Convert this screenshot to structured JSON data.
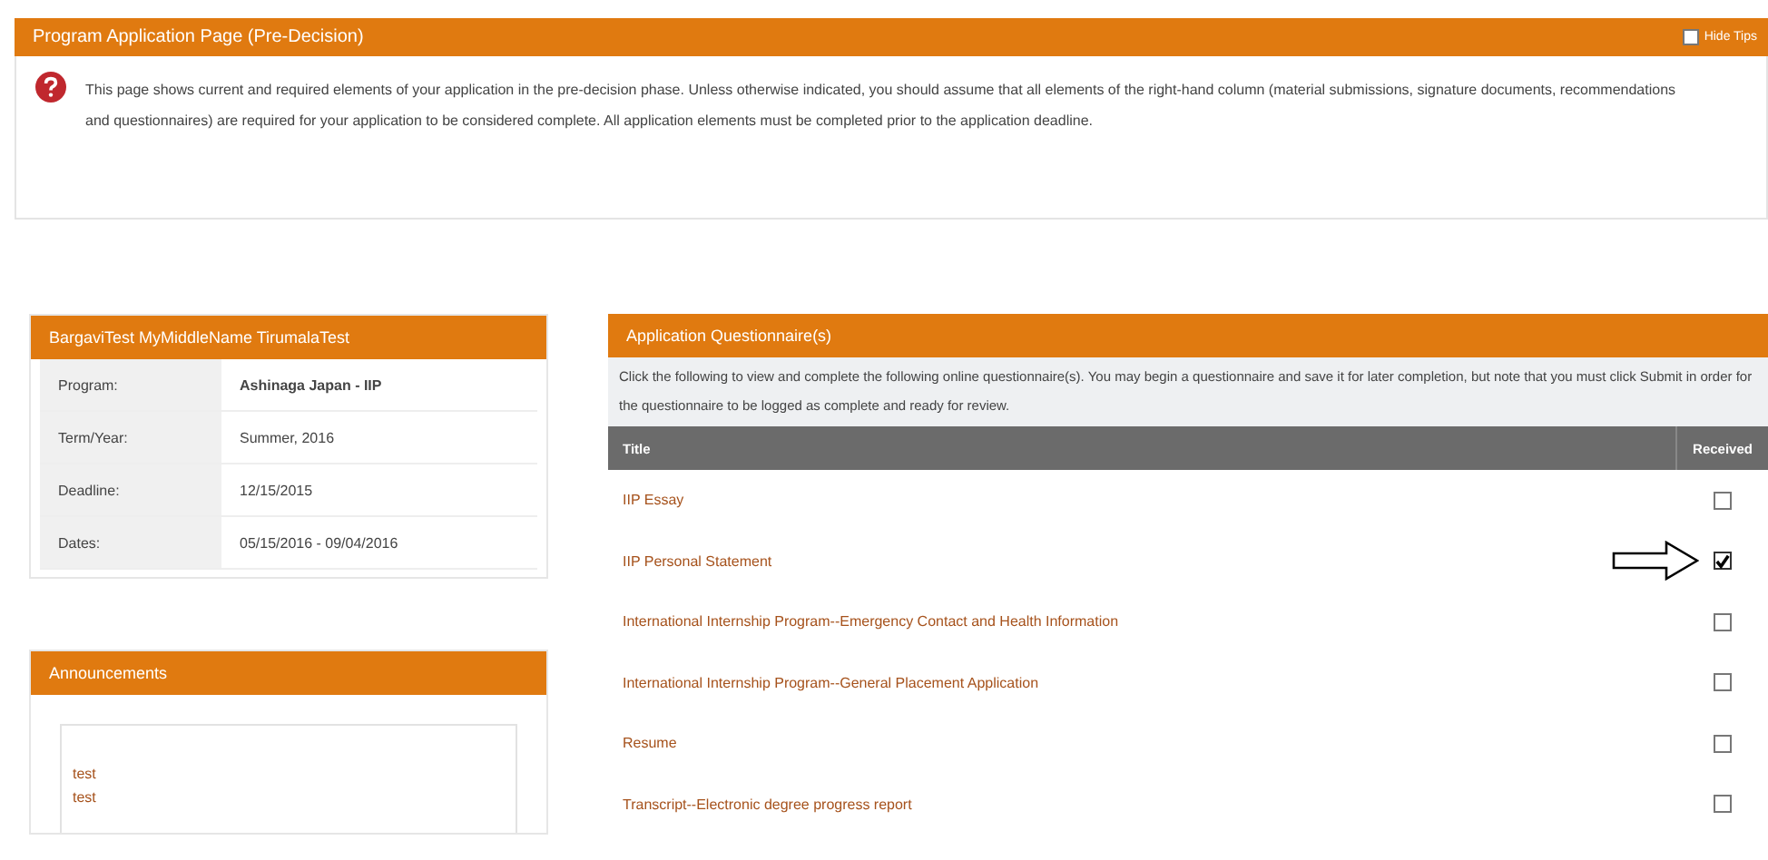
{
  "header": {
    "title": "Program Application Page (Pre-Decision)",
    "hide_tips": {
      "label": "Hide Tips",
      "checked": false
    }
  },
  "notice": "This page shows current and required elements of your application in the pre-decision phase. Unless otherwise indicated, you should assume that all elements of the right-hand column (material submissions, signature documents, recommendations and questionnaires) are required for your application to be considered complete. All application elements must be completed prior to the application deadline.",
  "applicant": {
    "title": "BargaviTest MyMiddleName TirumalaTest",
    "rows": [
      {
        "label": "Program:",
        "value": "Ashinaga Japan - IIP",
        "bold": true
      },
      {
        "label": "Term/Year:",
        "value": "Summer, 2016",
        "bold": false
      },
      {
        "label": "Deadline:",
        "value": "12/15/2015",
        "bold": false
      },
      {
        "label": "Dates:",
        "value": "05/15/2016 - 09/04/2016",
        "bold": false
      }
    ]
  },
  "announcements": {
    "title": "Announcements",
    "items": [
      "test",
      "test"
    ]
  },
  "questionnaires": {
    "title": "Application Questionnaire(s)",
    "intro": "Click the following to view and complete the following online questionnaire(s). You may begin a questionnaire and save it for later completion, but note that you must click Submit in order for the questionnaire to be logged as complete and ready for review.",
    "columns": [
      "Title",
      "Received"
    ],
    "rows": [
      {
        "title": "IIP Essay",
        "received": false
      },
      {
        "title": "IIP Personal Statement",
        "received": true
      },
      {
        "title": "International Internship Program--Emergency Contact and Health Information",
        "received": false
      },
      {
        "title": "International Internship Program--General Placement Application",
        "received": false
      },
      {
        "title": "Resume",
        "received": false
      },
      {
        "title": "Transcript--Electronic degree progress report",
        "received": false
      }
    ]
  }
}
